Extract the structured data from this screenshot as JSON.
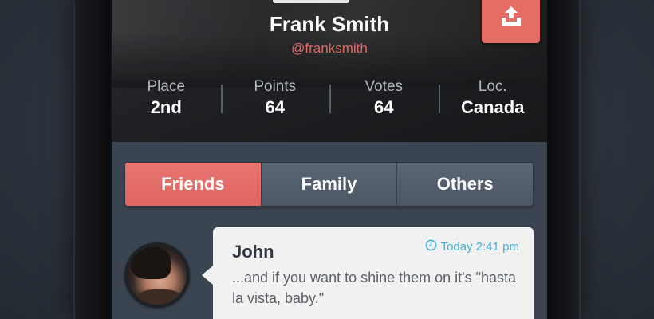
{
  "profile": {
    "name": "Frank Smith",
    "handle": "@franksmith"
  },
  "stats": [
    {
      "label": "Place",
      "value": "2nd"
    },
    {
      "label": "Points",
      "value": "64"
    },
    {
      "label": "Votes",
      "value": "64"
    },
    {
      "label": "Loc.",
      "value": "Canada"
    }
  ],
  "tabs": [
    {
      "label": "Friends",
      "active": true
    },
    {
      "label": "Family",
      "active": false
    },
    {
      "label": "Others",
      "active": false
    }
  ],
  "message": {
    "author": "John",
    "time": "Today 2:41 pm",
    "text": "...and if you want to shine them on it's \"hasta la vista, baby.\""
  },
  "icons": {
    "upload": "upload-icon",
    "clock": "clock-icon"
  },
  "colors": {
    "accent": "#e66c66",
    "time": "#46aed6",
    "background": "#3b4551"
  }
}
